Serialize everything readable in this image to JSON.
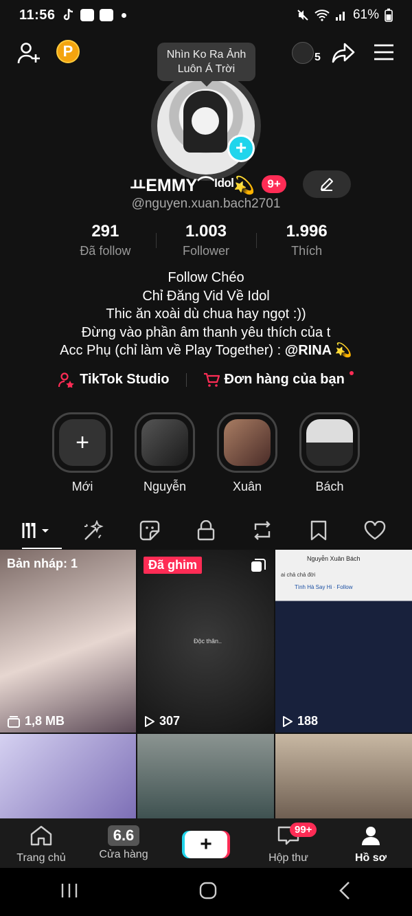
{
  "status_bar": {
    "time": "11:56",
    "battery": "61%"
  },
  "tooltip": {
    "line1": "Nhìn Ko Ra Ảnh",
    "line2": "Luôn Á Trời"
  },
  "top_right": {
    "count": "5"
  },
  "profile": {
    "name": "ㅛEMMY⌒ᴵᵈᵒˡ💫",
    "badge": "9+",
    "handle": "@nguyen.xuan.bach2701"
  },
  "stats": [
    {
      "value": "291",
      "label": "Đã follow"
    },
    {
      "value": "1.003",
      "label": "Follower"
    },
    {
      "value": "1.996",
      "label": "Thích"
    }
  ],
  "bio": {
    "line1": "Follow Chéo",
    "line2": "Chỉ Đăng Vid Về Idol",
    "line3": "Thic ăn xoài dù chua hay ngọt :))",
    "line4": "Đừng vào phần âm thanh yêu thích của t",
    "line5_prefix": "Acc Phụ (chỉ làm về Play Together) : ",
    "line5_mention": "@RINA 💫"
  },
  "links": {
    "studio": "TikTok Studio",
    "orders": "Đơn hàng của bạn"
  },
  "highlights": [
    {
      "label": "Mới"
    },
    {
      "label": "Nguyễn"
    },
    {
      "label": "Xuân"
    },
    {
      "label": "Bách"
    }
  ],
  "grid": {
    "draft_label": "Bản nháp: 1",
    "draft_size": "1,8 MB",
    "pinned_label": "Đã ghim",
    "pinned_views": "307",
    "video3_views": "188",
    "video2_caption": "Độc thân..",
    "video3_top_name": "Nguyễn Xuân Bách",
    "video3_sub": "ai chả chả đời",
    "video3_page": "Tình Hà Say Hi · Follow"
  },
  "bottom_nav": {
    "home": "Trang chủ",
    "shop": "Cửa hàng",
    "shop_icon_text": "6.6",
    "inbox": "Hộp thư",
    "inbox_badge": "99+",
    "profile": "Hồ sơ"
  },
  "colors": {
    "accent": "#fe2c55",
    "cyan": "#20d5ec",
    "bg": "#121212"
  }
}
